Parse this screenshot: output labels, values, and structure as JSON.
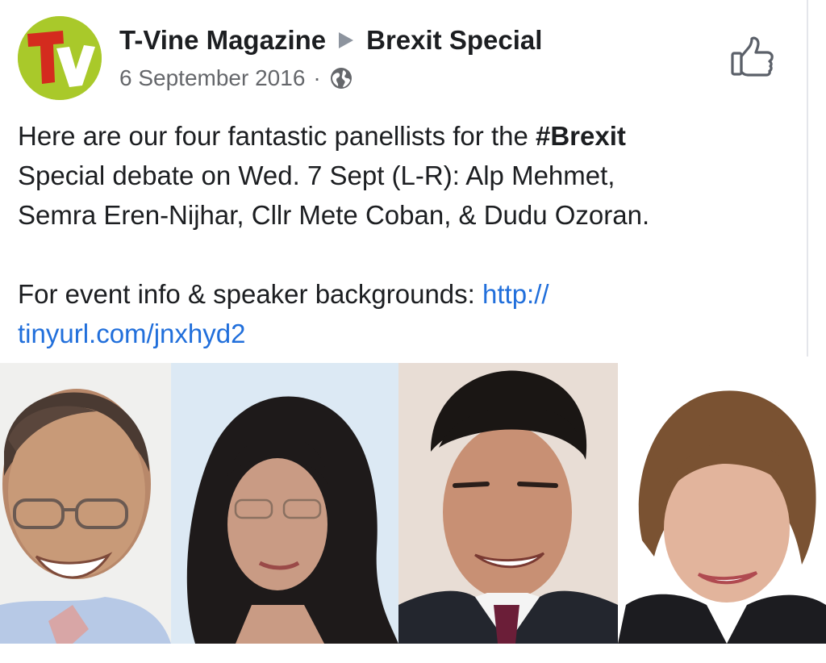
{
  "post": {
    "page_name": "T-Vine Magazine",
    "separator_icon": "right-triangle-icon",
    "event_name": "Brexit Special",
    "date": "6 September 2016",
    "meta_separator": "·",
    "audience_icon": "globe-icon",
    "like_icon": "thumbs-up-icon",
    "avatar_letters": "TV",
    "text": {
      "intro": "Here are our four fantastic panellists for the ",
      "hashtag": "#Brexit",
      "line2": "Special debate on Wed. 7 Sept (L-R): Alp Mehmet,",
      "line3": "Semra Eren-Nijhar, Cllr Mete Coban, & Dudu Ozoran.",
      "info_prefix": "For event info & speaker backgrounds: ",
      "link_part1": "http://",
      "link_part2": "tinyurl.com/jnxhyd2"
    }
  },
  "photos": [
    {
      "subject": "man-with-glasses-photo"
    },
    {
      "subject": "woman-with-dark-hair-photo"
    },
    {
      "subject": "young-man-in-suit-photo"
    },
    {
      "subject": "woman-with-short-hair-photo"
    }
  ],
  "colors": {
    "text": "#1c1e21",
    "secondary": "#65676b",
    "link": "#216fdb",
    "avatar_bg": "#a9c92a",
    "logo_red": "#d42b1e"
  }
}
